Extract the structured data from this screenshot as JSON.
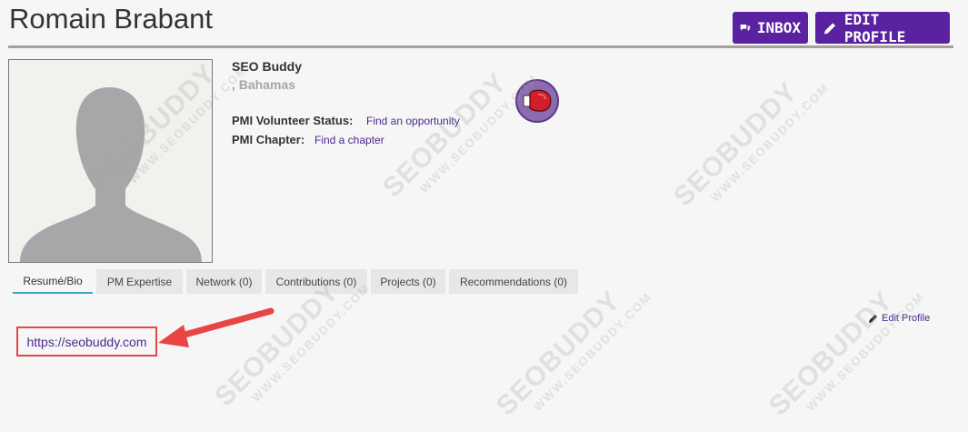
{
  "header": {
    "name": "Romain Brabant",
    "inbox_label": "INBOX",
    "edit_profile_label": "EDIT PROFILE"
  },
  "profile": {
    "organization": "SEO Buddy",
    "location": ", Bahamas",
    "volunteer_label": "PMI Volunteer Status:",
    "volunteer_link": "Find an opportunity",
    "chapter_label": "PMI Chapter:",
    "chapter_link": "Find a chapter"
  },
  "tabs": [
    {
      "label": "Resumé/Bio",
      "active": true
    },
    {
      "label": "PM Expertise",
      "active": false
    },
    {
      "label": "Network (0)",
      "active": false
    },
    {
      "label": "Contributions (0)",
      "active": false
    },
    {
      "label": "Projects (0)",
      "active": false
    },
    {
      "label": "Recommendations (0)",
      "active": false
    }
  ],
  "bio": {
    "edit_link": "Edit Profile",
    "website_url": "https://seobuddy.com"
  },
  "watermark": {
    "brand": "SEOBUDDY",
    "site": "WWW.SEOBUDDY.COM"
  },
  "colors": {
    "brand_purple": "#5a22a0",
    "link_purple": "#4a2a8c",
    "annotation_red": "#e84545",
    "active_tab_underline": "#3aa6c0"
  }
}
